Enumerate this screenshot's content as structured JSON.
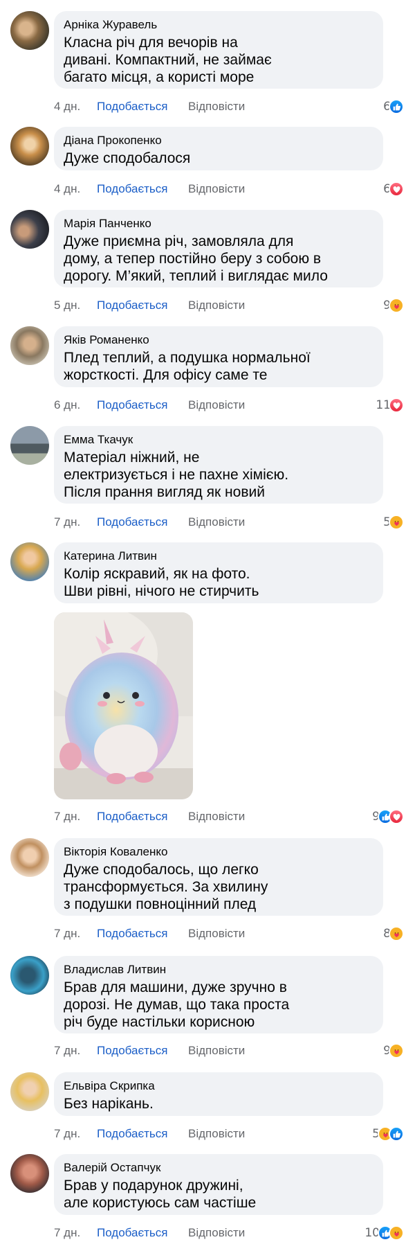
{
  "actions": {
    "like": "Подобається",
    "reply": "Відповісти"
  },
  "comments": [
    {
      "author": "Арніка Журавель",
      "lines": [
        "Класна річ для вечорів на",
        "дивані. Компактний, не займає",
        "багато місця, а користі море"
      ],
      "time": "4 дн.",
      "count": "6",
      "reactions": [
        "like"
      ]
    },
    {
      "author": "Діана Прокопенко",
      "lines": [
        "Дуже сподобалося"
      ],
      "time": "4 дн.",
      "count": "6",
      "reactions": [
        "love"
      ]
    },
    {
      "author": "Марія Панченко",
      "lines": [
        "Дуже приємна річ, замовляла для",
        "дому, а тепер постійно беру з собою в",
        "дорогу. М’який, теплий і виглядає мило"
      ],
      "time": "5 дн.",
      "count": "9",
      "reactions": [
        "care"
      ]
    },
    {
      "author": "Яків Романенко",
      "lines": [
        "Плед теплий, а подушка нормальної",
        "жорсткості. Для офісу саме те"
      ],
      "time": "6 дн.",
      "count": "11",
      "reactions": [
        "love"
      ]
    },
    {
      "author": "Емма Ткачук",
      "lines": [
        "Матеріал ніжний, не",
        "електризується і не пахне хімією.",
        "Після прання вигляд як новий"
      ],
      "time": "7 дн.",
      "count": "5",
      "reactions": [
        "care"
      ]
    },
    {
      "author": "Катерина Литвин",
      "lines": [
        "Колір яскравий, як на фото.",
        "Шви рівні, нічого не стирчить"
      ],
      "time": "7 дн.",
      "count": "9",
      "reactions": [
        "like",
        "love"
      ]
    },
    {
      "author": "Вікторія Коваленко",
      "lines": [
        "Дуже сподобалось, що легко",
        "трансформується. За хвилину",
        "з подушки повноцінний плед"
      ],
      "time": "7 дн.",
      "count": "8",
      "reactions": [
        "care"
      ]
    },
    {
      "author": "Владислав Литвин",
      "lines": [
        "Брав для машини, дуже зручно в",
        "дорозі. Не думав, що така проста",
        "річ буде настільки корисною"
      ],
      "time": "7 дн.",
      "count": "9",
      "reactions": [
        "care"
      ]
    },
    {
      "author": "Ельвіра Скрипка",
      "lines": [
        "Без нарікань."
      ],
      "time": "7 дн.",
      "count": "5",
      "reactions": [
        "care",
        "like"
      ]
    },
    {
      "author": "Валерій Остапчук",
      "lines": [
        "Брав у подарунок дружині,",
        "але користуюсь сам частіше"
      ],
      "time": "7 дн.",
      "count": "10",
      "reactions": [
        "like",
        "care"
      ]
    }
  ],
  "colors": {
    "link": "#1b5ec7",
    "meta": "#65676b",
    "bubble": "#f0f2f5",
    "text": "#050505"
  }
}
